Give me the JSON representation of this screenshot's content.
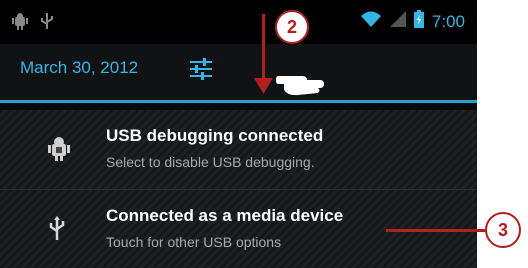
{
  "status_bar": {
    "left_icons": [
      "android-debug-icon",
      "usb-icon"
    ],
    "right_icons": [
      "wifi-icon",
      "signal-icon",
      "battery-icon"
    ],
    "time": "7:00"
  },
  "header": {
    "date": "March 30, 2012",
    "settings_icon": "settings-sliders-icon"
  },
  "notifications": [
    {
      "icon": "android-debug-icon",
      "title": "USB debugging connected",
      "subtitle": "Select to disable USB debugging."
    },
    {
      "icon": "usb-icon",
      "title": "Connected as a media device",
      "subtitle": "Touch for other USB options"
    }
  ],
  "callouts": {
    "step_2": "2",
    "step_3": "3"
  },
  "colors": {
    "accent": "#33b5e5",
    "callout": "#b0201f"
  },
  "gesture_icon": "swipe-down-hand-icon"
}
